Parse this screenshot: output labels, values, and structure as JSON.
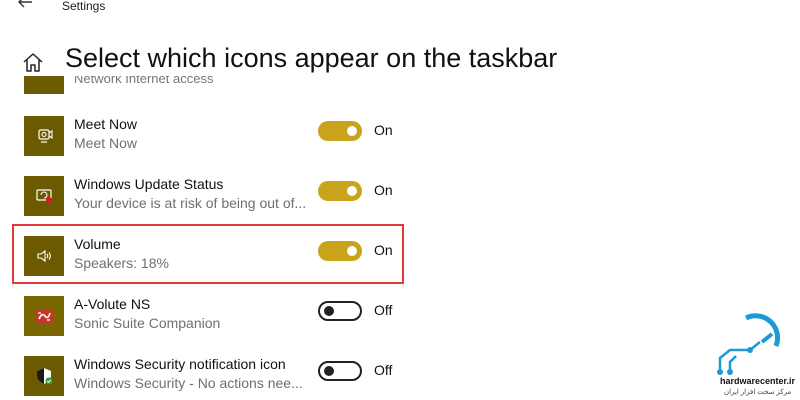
{
  "window": {
    "title": "Settings"
  },
  "header": {
    "title": "Select which icons appear on the taskbar"
  },
  "partial_item": {
    "subtitle": "Network Internet access"
  },
  "items": [
    {
      "name": "Meet Now",
      "subtitle": "Meet Now",
      "state": "On",
      "icon": "meet-now-icon"
    },
    {
      "name": "Windows Update Status",
      "subtitle": "Your device is at risk of being out of...",
      "state": "On",
      "icon": "windows-update-icon"
    },
    {
      "name": "Volume",
      "subtitle": "Speakers: 18%",
      "state": "On",
      "icon": "speaker-icon"
    },
    {
      "name": "A-Volute NS",
      "subtitle": "Sonic Suite Companion",
      "state": "Off",
      "icon": "sonic-suite-icon"
    },
    {
      "name": "Windows Security notification icon",
      "subtitle": "Windows Security - No actions nee...",
      "state": "Off",
      "icon": "windows-security-shield-icon"
    }
  ],
  "watermark": {
    "name": "hardwarecenter.ir",
    "subtitle": "مرکز سخت افزار ایران"
  },
  "colors": {
    "tile": "#6b5a00",
    "toggle_on": "#c9a31a",
    "highlight": "#e03a3a"
  }
}
